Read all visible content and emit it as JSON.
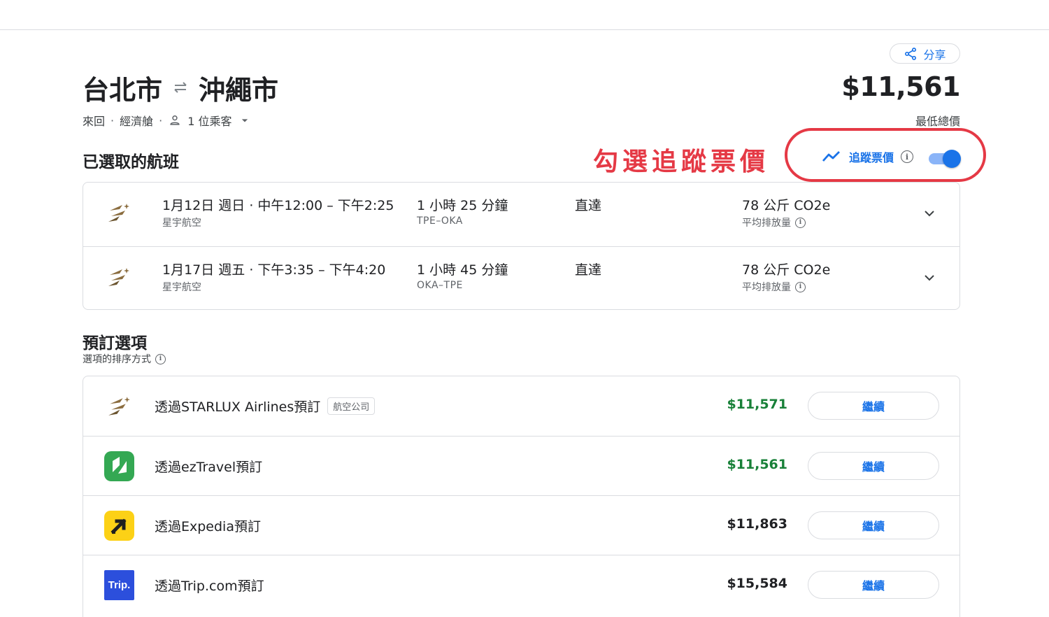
{
  "share": {
    "label": "分享"
  },
  "route": {
    "origin": "台北市",
    "destination": "沖繩市"
  },
  "meta": {
    "trip_type": "來回",
    "cabin": "經濟艙",
    "passengers": "1 位乘客"
  },
  "price": {
    "lowest": "$11,561",
    "lowest_label": "最低總價"
  },
  "selected_section": {
    "title": "已選取的航班"
  },
  "annotation": {
    "text": "勾選追蹤票價",
    "color": "#e53945"
  },
  "tracking": {
    "label": "追蹤票價",
    "enabled": true
  },
  "flights": [
    {
      "time": "1月12日 週日 · 中午12:00 – 下午2:25",
      "airline": "星宇航空",
      "duration": "1 小時 25 分鐘",
      "route_code": "TPE–OKA",
      "stops": "直達",
      "co2": "78 公斤 CO2e",
      "co2_label": "平均排放量"
    },
    {
      "time": "1月17日 週五 · 下午3:35 – 下午4:20",
      "airline": "星宇航空",
      "duration": "1 小時 45 分鐘",
      "route_code": "OKA–TPE",
      "stops": "直達",
      "co2": "78 公斤 CO2e",
      "co2_label": "平均排放量"
    }
  ],
  "booking": {
    "title": "預訂選項",
    "sort_label": "選項的排序方式",
    "options": [
      {
        "name": "透過STARLUX Airlines預訂",
        "badge": "航空公司",
        "price": "$11,571",
        "highlight": true,
        "button": "繼續",
        "logo": "starlux-icon"
      },
      {
        "name": "透過ezTravel預訂",
        "price": "$11,561",
        "highlight": true,
        "button": "繼續",
        "logo": "eztravel-icon"
      },
      {
        "name": "透過Expedia預訂",
        "price": "$11,863",
        "highlight": false,
        "button": "繼續",
        "logo": "expedia-icon"
      },
      {
        "name": "透過Trip.com預訂",
        "price": "$15,584",
        "highlight": false,
        "button": "繼續",
        "logo": "tripcom-icon",
        "logo_text": "Trip."
      }
    ]
  },
  "colors": {
    "accent": "#1a73e8",
    "green_price": "#188038",
    "annotation": "#e53945",
    "starlux_gold": "#8b6d3f",
    "eztravel_green": "#34a853",
    "expedia_yellow": "#fcd116",
    "tripcom_blue": "#2c4fdc"
  }
}
